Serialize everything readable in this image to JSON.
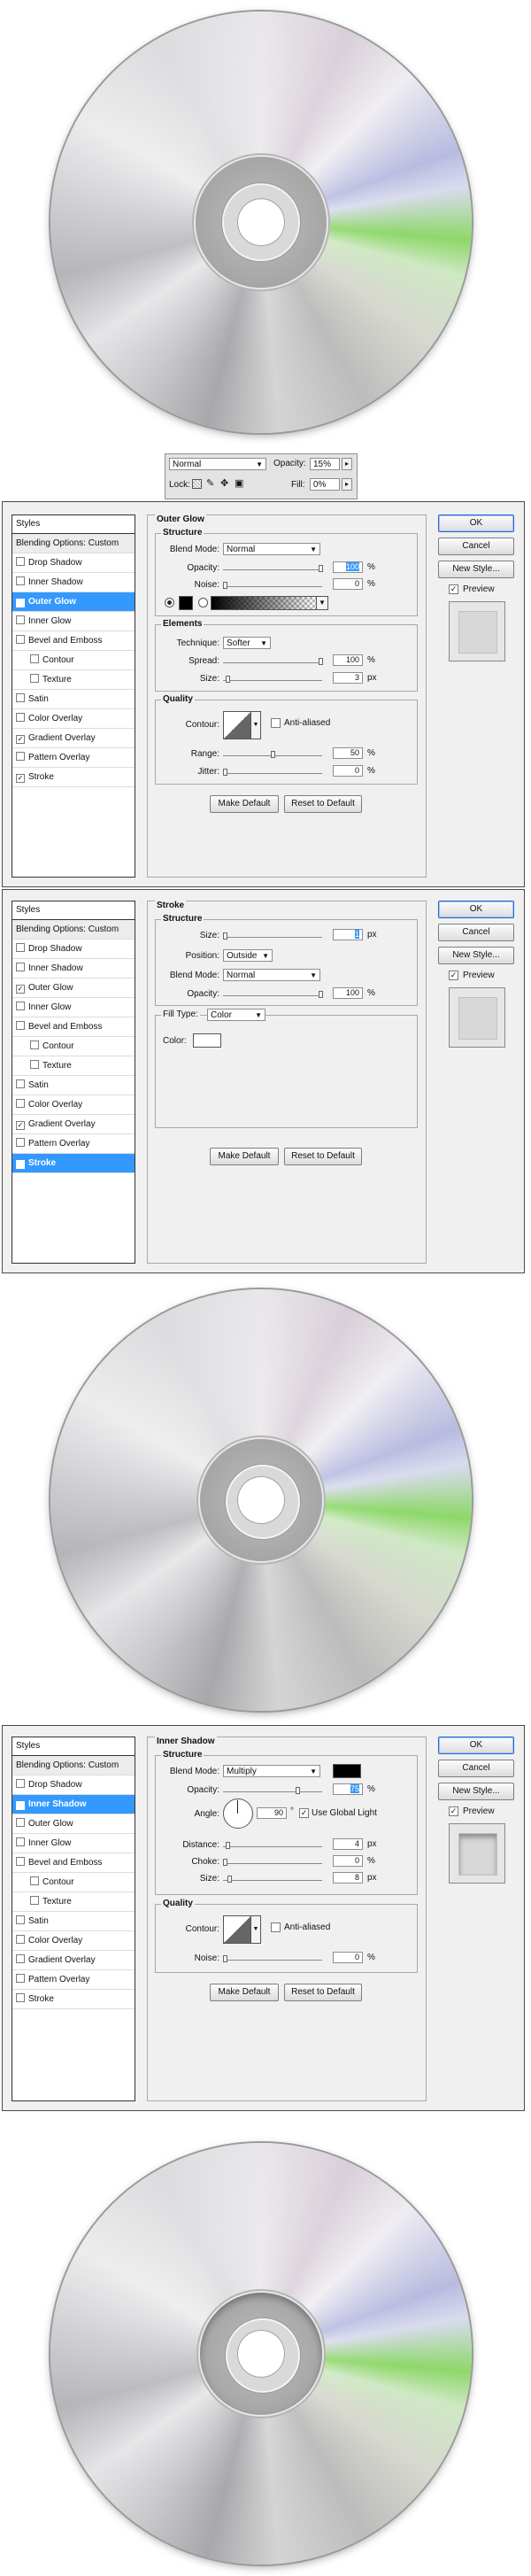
{
  "colors": {
    "accent": "#3399ff",
    "panel": "#f0f0f0",
    "border": "#4a4a4a"
  },
  "layers": {
    "blend_mode": "Normal",
    "opacity_label": "Opacity:",
    "opacity_value": "15%",
    "lock_label": "Lock:",
    "fill_label": "Fill:",
    "fill_value": "0%"
  },
  "common": {
    "styles_header": "Styles",
    "blending_options": "Blending Options: Custom",
    "ok": "OK",
    "cancel": "Cancel",
    "new_style": "New Style...",
    "preview": "Preview",
    "make_default": "Make Default",
    "reset_default": "Reset to Default",
    "items": [
      "Drop Shadow",
      "Inner Shadow",
      "Outer Glow",
      "Inner Glow",
      "Bevel and Emboss",
      "Contour",
      "Texture",
      "Satin",
      "Color Overlay",
      "Gradient Overlay",
      "Pattern Overlay",
      "Stroke"
    ]
  },
  "outer_glow": {
    "title": "Outer Glow",
    "structure": "Structure",
    "blend_mode_label": "Blend Mode:",
    "blend_mode": "Normal",
    "opacity_label": "Opacity:",
    "opacity": "100",
    "noise_label": "Noise:",
    "noise": "0",
    "elements": "Elements",
    "technique_label": "Technique:",
    "technique": "Softer",
    "spread_label": "Spread:",
    "spread": "100",
    "size_label": "Size:",
    "size": "3",
    "quality": "Quality",
    "contour_label": "Contour:",
    "anti_aliased": "Anti-aliased",
    "range_label": "Range:",
    "range": "50",
    "jitter_label": "Jitter:",
    "jitter": "0",
    "pct": "%",
    "px": "px"
  },
  "stroke": {
    "title": "Stroke",
    "structure": "Structure",
    "size_label": "Size:",
    "size": "1",
    "position_label": "Position:",
    "position": "Outside",
    "blend_mode_label": "Blend Mode:",
    "blend_mode": "Normal",
    "opacity_label": "Opacity:",
    "opacity": "100",
    "fill_type_label": "Fill Type:",
    "fill_type": "Color",
    "color_label": "Color:",
    "pct": "%",
    "px": "px"
  },
  "inner_shadow": {
    "title": "Inner Shadow",
    "structure": "Structure",
    "blend_mode_label": "Blend Mode:",
    "blend_mode": "Multiply",
    "opacity_label": "Opacity:",
    "opacity": "75",
    "angle_label": "Angle:",
    "angle": "90",
    "degree": "°",
    "global_light": "Use Global Light",
    "distance_label": "Distance:",
    "distance": "4",
    "choke_label": "Choke:",
    "choke": "0",
    "size_label": "Size:",
    "size": "8",
    "quality": "Quality",
    "contour_label": "Contour:",
    "anti_aliased": "Anti-aliased",
    "noise_label": "Noise:",
    "noise": "0",
    "pct": "%",
    "px": "px"
  }
}
